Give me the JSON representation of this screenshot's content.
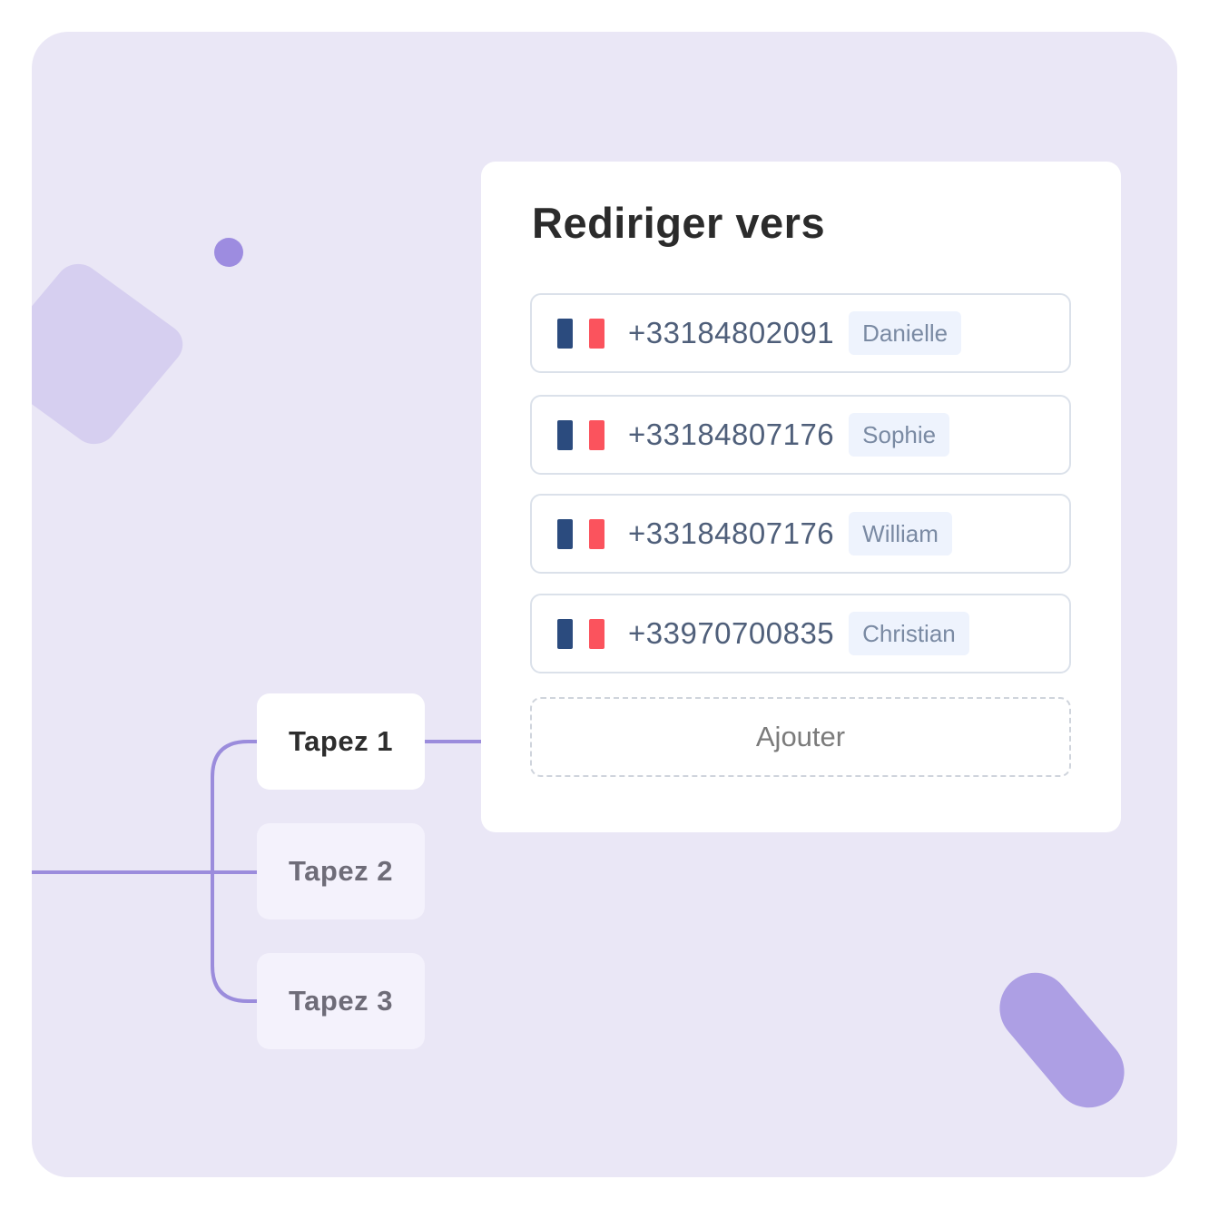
{
  "panel": {
    "title": "Rediriger vers",
    "destinations": [
      {
        "flag": "france-flag",
        "phone": "+33184802091",
        "name": "Danielle"
      },
      {
        "flag": "france-flag",
        "phone": "+33184807176",
        "name": "Sophie"
      },
      {
        "flag": "france-flag",
        "phone": "+33184807176",
        "name": "William"
      },
      {
        "flag": "france-flag",
        "phone": "+33970700835",
        "name": "Christian"
      }
    ],
    "add_label": "Ajouter"
  },
  "menu": {
    "keys": [
      {
        "label": "Tapez 1",
        "state": "active"
      },
      {
        "label": "Tapez 2",
        "state": "inactive"
      },
      {
        "label": "Tapez 3",
        "state": "inactive"
      }
    ]
  },
  "colors": {
    "background": "#eae7f6",
    "accent": "#9d8ce0",
    "connector": "#9b8cdc",
    "flag_blue": "#2b4b7e",
    "flag_red": "#fb535d"
  }
}
